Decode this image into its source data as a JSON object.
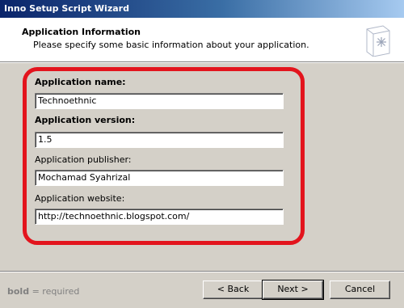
{
  "window": {
    "title": "Inno Setup Script Wizard"
  },
  "header": {
    "title": "Application Information",
    "description": "Please specify some basic information about your application.",
    "icon": "wizard-page-icon"
  },
  "form": {
    "name_label": "Application name:",
    "name_value": "Technoethnic",
    "version_label": "Application version:",
    "version_value": "1.5",
    "publisher_label": "Application publisher:",
    "publisher_value": "Mochamad Syahrizal",
    "website_label": "Application website:",
    "website_value": "http://technoethnic.blogspot.com/"
  },
  "footer": {
    "note_bold": "bold",
    "note_rest": " = required",
    "back_label": "< Back",
    "next_label": "Next >",
    "cancel_label": "Cancel"
  },
  "colors": {
    "highlight_outline": "#e3141d",
    "titlebar": "#0a246a",
    "face": "#d4d0c8"
  }
}
